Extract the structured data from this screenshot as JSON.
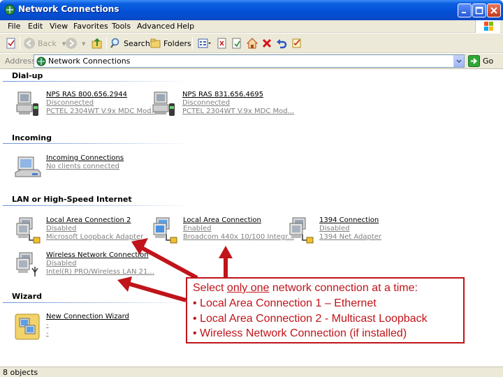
{
  "window": {
    "title": "Network Connections"
  },
  "menu": {
    "items": [
      "File",
      "Edit",
      "View",
      "Favorites",
      "Tools",
      "Advanced",
      "Help"
    ]
  },
  "toolbar": {
    "back": "Back",
    "search": "Search",
    "folders": "Folders"
  },
  "address": {
    "label": "Address",
    "value": "Network Connections",
    "go": "Go"
  },
  "groups": {
    "dialup": "Dial-up",
    "incoming": "Incoming",
    "lan": "LAN or High-Speed Internet",
    "wizard": "Wizard"
  },
  "items": {
    "ras1": {
      "name": "NPS RAS 800.656.2944",
      "status": "Disconnected",
      "device": "PCTEL 2304WT V.9x MDC Mod..."
    },
    "ras2": {
      "name": "NPS RAS 831.656.4695",
      "status": "Disconnected",
      "device": "PCTEL 2304WT V.9x MDC Mod..."
    },
    "incoming": {
      "name": "Incoming Connections",
      "status": "No clients connected"
    },
    "lac2": {
      "name": "Local Area Connection 2",
      "status": "Disabled",
      "device": "Microsoft Loopback Adapter"
    },
    "lac": {
      "name": "Local Area Connection",
      "status": "Enabled",
      "device": "Broadcom 440x 10/100 Integr..."
    },
    "c1394": {
      "name": "1394 Connection",
      "status": "Disabled",
      "device": "1394 Net Adapter"
    },
    "wireless": {
      "name": "Wireless Network Connection",
      "status": "Disabled",
      "device": "Intel(R) PRO/Wireless LAN 21..."
    },
    "wizard": {
      "name": "New Connection Wizard",
      "status": "-",
      "device": "-"
    }
  },
  "callout": {
    "line1_pre": "Select ",
    "line1_u": "only one",
    "line1_post": " network connection at a time:",
    "line2": "• Local Area Connection 1 – Ethernet",
    "line3": "• Local Area Connection 2 - Multicast Loopback",
    "line4": "• Wireless Network Connection (if installed)"
  },
  "statusbar": {
    "text": "8 objects"
  },
  "colors": {
    "callout": "#c0141a",
    "titlebar": "#0450d6",
    "chrome": "#ece9d8"
  }
}
